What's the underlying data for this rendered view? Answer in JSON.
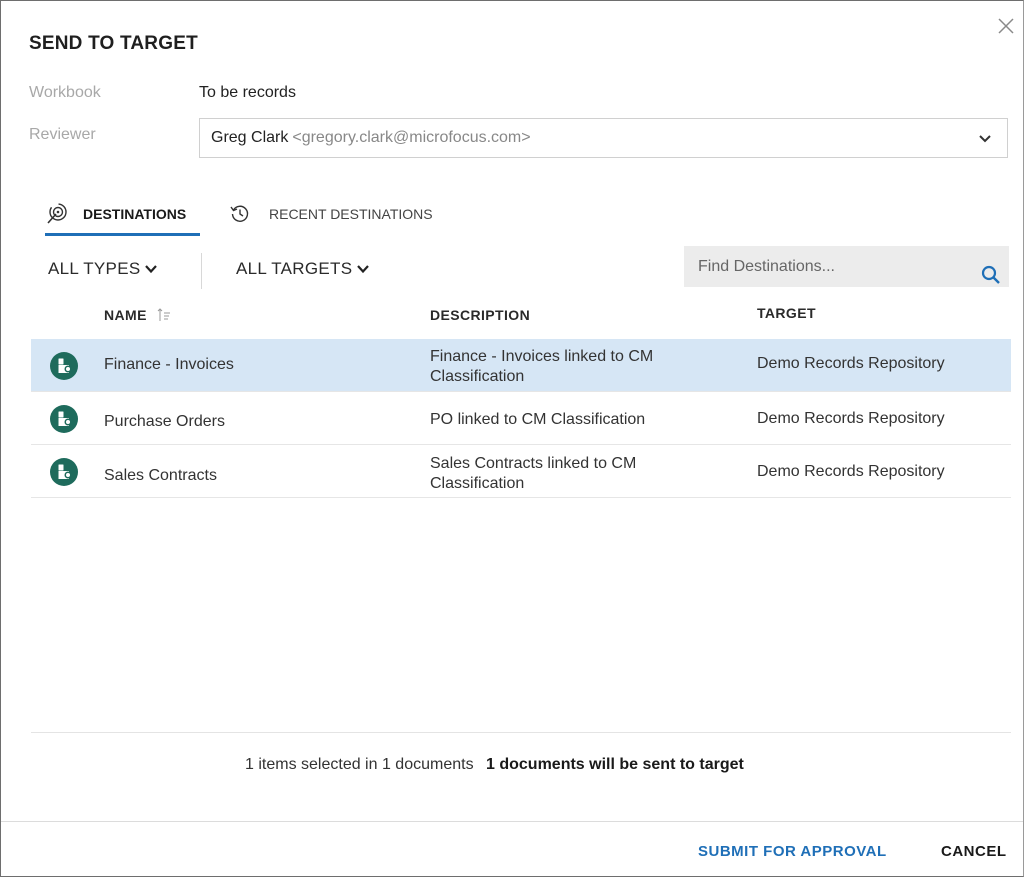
{
  "dialog": {
    "title": "SEND TO TARGET",
    "close_icon": "close-icon"
  },
  "workbook": {
    "label": "Workbook",
    "value": "To be records"
  },
  "reviewer": {
    "label": "Reviewer",
    "name": "Greg Clark",
    "email": "<gregory.clark@microfocus.com>",
    "icon": "chevron-down-icon"
  },
  "tabs": [
    {
      "label": "DESTINATIONS",
      "icon": "destinations-icon",
      "active": true
    },
    {
      "label": "RECENT DESTINATIONS",
      "icon": "history-icon",
      "active": false
    }
  ],
  "filters": {
    "types_label": "ALL TYPES",
    "targets_label": "ALL TARGETS"
  },
  "search": {
    "placeholder": "Find Destinations...",
    "icon": "search-icon"
  },
  "table": {
    "columns": {
      "name": "NAME",
      "description": "DESCRIPTION",
      "target": "TARGET"
    },
    "rows": [
      {
        "name": "Finance - Invoices",
        "description": "Finance - Invoices linked to CM Classification",
        "target": "Demo Records Repository",
        "selected": true,
        "icon": "records-classification-icon"
      },
      {
        "name": "Purchase Orders",
        "description": "PO linked to CM Classification",
        "target": "Demo Records Repository",
        "selected": false,
        "icon": "records-classification-icon"
      },
      {
        "name": "Sales Contracts",
        "description": "Sales Contracts linked to CM Classification",
        "target": "Demo Records Repository",
        "selected": false,
        "icon": "records-classification-icon"
      }
    ]
  },
  "status": {
    "selected_text": "1 items selected in 1 documents",
    "result_text": "1 documents will be sent to target"
  },
  "actions": {
    "submit_label": "SUBMIT FOR APPROVAL",
    "cancel_label": "CANCEL"
  },
  "colors": {
    "accent": "#1f6fb7",
    "icon_green": "#1e6b5c",
    "selected_row": "#d6e6f5"
  }
}
